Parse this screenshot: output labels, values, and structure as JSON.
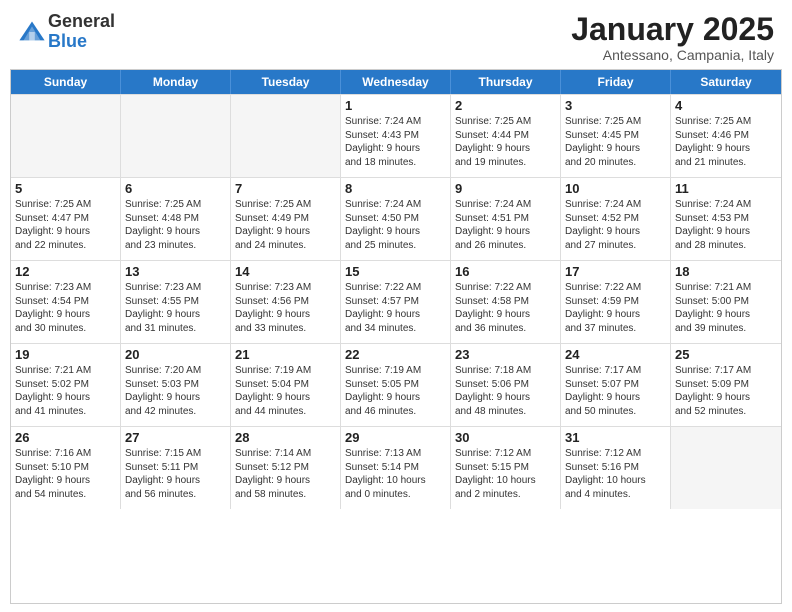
{
  "header": {
    "logo_general": "General",
    "logo_blue": "Blue",
    "month_title": "January 2025",
    "location": "Antessano, Campania, Italy"
  },
  "weekdays": [
    "Sunday",
    "Monday",
    "Tuesday",
    "Wednesday",
    "Thursday",
    "Friday",
    "Saturday"
  ],
  "rows": [
    [
      {
        "day": "",
        "info": ""
      },
      {
        "day": "",
        "info": ""
      },
      {
        "day": "",
        "info": ""
      },
      {
        "day": "1",
        "info": "Sunrise: 7:24 AM\nSunset: 4:43 PM\nDaylight: 9 hours\nand 18 minutes."
      },
      {
        "day": "2",
        "info": "Sunrise: 7:25 AM\nSunset: 4:44 PM\nDaylight: 9 hours\nand 19 minutes."
      },
      {
        "day": "3",
        "info": "Sunrise: 7:25 AM\nSunset: 4:45 PM\nDaylight: 9 hours\nand 20 minutes."
      },
      {
        "day": "4",
        "info": "Sunrise: 7:25 AM\nSunset: 4:46 PM\nDaylight: 9 hours\nand 21 minutes."
      }
    ],
    [
      {
        "day": "5",
        "info": "Sunrise: 7:25 AM\nSunset: 4:47 PM\nDaylight: 9 hours\nand 22 minutes."
      },
      {
        "day": "6",
        "info": "Sunrise: 7:25 AM\nSunset: 4:48 PM\nDaylight: 9 hours\nand 23 minutes."
      },
      {
        "day": "7",
        "info": "Sunrise: 7:25 AM\nSunset: 4:49 PM\nDaylight: 9 hours\nand 24 minutes."
      },
      {
        "day": "8",
        "info": "Sunrise: 7:24 AM\nSunset: 4:50 PM\nDaylight: 9 hours\nand 25 minutes."
      },
      {
        "day": "9",
        "info": "Sunrise: 7:24 AM\nSunset: 4:51 PM\nDaylight: 9 hours\nand 26 minutes."
      },
      {
        "day": "10",
        "info": "Sunrise: 7:24 AM\nSunset: 4:52 PM\nDaylight: 9 hours\nand 27 minutes."
      },
      {
        "day": "11",
        "info": "Sunrise: 7:24 AM\nSunset: 4:53 PM\nDaylight: 9 hours\nand 28 minutes."
      }
    ],
    [
      {
        "day": "12",
        "info": "Sunrise: 7:23 AM\nSunset: 4:54 PM\nDaylight: 9 hours\nand 30 minutes."
      },
      {
        "day": "13",
        "info": "Sunrise: 7:23 AM\nSunset: 4:55 PM\nDaylight: 9 hours\nand 31 minutes."
      },
      {
        "day": "14",
        "info": "Sunrise: 7:23 AM\nSunset: 4:56 PM\nDaylight: 9 hours\nand 33 minutes."
      },
      {
        "day": "15",
        "info": "Sunrise: 7:22 AM\nSunset: 4:57 PM\nDaylight: 9 hours\nand 34 minutes."
      },
      {
        "day": "16",
        "info": "Sunrise: 7:22 AM\nSunset: 4:58 PM\nDaylight: 9 hours\nand 36 minutes."
      },
      {
        "day": "17",
        "info": "Sunrise: 7:22 AM\nSunset: 4:59 PM\nDaylight: 9 hours\nand 37 minutes."
      },
      {
        "day": "18",
        "info": "Sunrise: 7:21 AM\nSunset: 5:00 PM\nDaylight: 9 hours\nand 39 minutes."
      }
    ],
    [
      {
        "day": "19",
        "info": "Sunrise: 7:21 AM\nSunset: 5:02 PM\nDaylight: 9 hours\nand 41 minutes."
      },
      {
        "day": "20",
        "info": "Sunrise: 7:20 AM\nSunset: 5:03 PM\nDaylight: 9 hours\nand 42 minutes."
      },
      {
        "day": "21",
        "info": "Sunrise: 7:19 AM\nSunset: 5:04 PM\nDaylight: 9 hours\nand 44 minutes."
      },
      {
        "day": "22",
        "info": "Sunrise: 7:19 AM\nSunset: 5:05 PM\nDaylight: 9 hours\nand 46 minutes."
      },
      {
        "day": "23",
        "info": "Sunrise: 7:18 AM\nSunset: 5:06 PM\nDaylight: 9 hours\nand 48 minutes."
      },
      {
        "day": "24",
        "info": "Sunrise: 7:17 AM\nSunset: 5:07 PM\nDaylight: 9 hours\nand 50 minutes."
      },
      {
        "day": "25",
        "info": "Sunrise: 7:17 AM\nSunset: 5:09 PM\nDaylight: 9 hours\nand 52 minutes."
      }
    ],
    [
      {
        "day": "26",
        "info": "Sunrise: 7:16 AM\nSunset: 5:10 PM\nDaylight: 9 hours\nand 54 minutes."
      },
      {
        "day": "27",
        "info": "Sunrise: 7:15 AM\nSunset: 5:11 PM\nDaylight: 9 hours\nand 56 minutes."
      },
      {
        "day": "28",
        "info": "Sunrise: 7:14 AM\nSunset: 5:12 PM\nDaylight: 9 hours\nand 58 minutes."
      },
      {
        "day": "29",
        "info": "Sunrise: 7:13 AM\nSunset: 5:14 PM\nDaylight: 10 hours\nand 0 minutes."
      },
      {
        "day": "30",
        "info": "Sunrise: 7:12 AM\nSunset: 5:15 PM\nDaylight: 10 hours\nand 2 minutes."
      },
      {
        "day": "31",
        "info": "Sunrise: 7:12 AM\nSunset: 5:16 PM\nDaylight: 10 hours\nand 4 minutes."
      },
      {
        "day": "",
        "info": ""
      }
    ]
  ]
}
